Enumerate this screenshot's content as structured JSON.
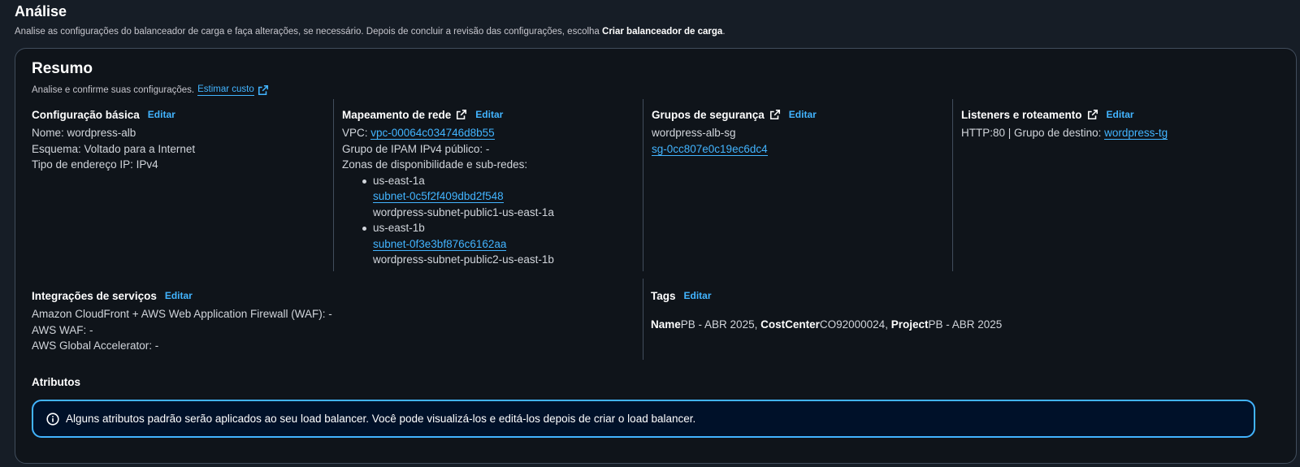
{
  "page": {
    "title": "Análise",
    "description_prefix": "Analise as configurações do balanceador de carga e faça alterações, se necessário. Depois de concluir a revisão das configurações, escolha ",
    "description_bold": "Criar balanceador de carga",
    "description_suffix": "."
  },
  "summary": {
    "title": "Resumo",
    "subtitle": "Analise e confirme suas configurações.",
    "estimate_link": "Estimar custo"
  },
  "basic_config": {
    "heading": "Configuração básica",
    "edit": "Editar",
    "name": "Nome: wordpress-alb",
    "scheme": "Esquema: Voltado para a Internet",
    "ip_type": "Tipo de endereço IP: IPv4"
  },
  "network_mapping": {
    "heading": "Mapeamento de rede",
    "edit": "Editar",
    "vpc_label": "VPC: ",
    "vpc_id": "vpc-00064c034746d8b55",
    "ipam": "Grupo de IPAM IPv4 público: -",
    "zones_label": "Zonas de disponibilidade e sub-redes:",
    "zones": [
      {
        "zone": "us-east-1a",
        "subnet_id": "subnet-0c5f2f409dbd2f548",
        "subnet_name": "wordpress-subnet-public1-us-east-1a"
      },
      {
        "zone": "us-east-1b",
        "subnet_id": "subnet-0f3e3bf876c6162aa",
        "subnet_name": "wordpress-subnet-public2-us-east-1b"
      }
    ]
  },
  "security_groups": {
    "heading": "Grupos de segurança",
    "edit": "Editar",
    "group_name": "wordpress-alb-sg",
    "group_id": "sg-0cc807e0c19ec6dc4"
  },
  "listeners": {
    "heading": "Listeners e roteamento",
    "edit": "Editar",
    "rule_prefix": "HTTP:80 | Grupo de destino: ",
    "target_group": "wordpress-tg"
  },
  "integrations": {
    "heading": "Integrações de serviços",
    "edit": "Editar",
    "lines": [
      "Amazon CloudFront + AWS Web Application Firewall (WAF): -",
      "AWS WAF: -",
      "AWS Global Accelerator: -"
    ]
  },
  "tags": {
    "heading": "Tags",
    "edit": "Editar",
    "items": [
      {
        "key": "Name",
        "value": "PB - ABR 2025",
        "sep": ", "
      },
      {
        "key": "CostCenter",
        "value": "CO92000024",
        "sep": ", "
      },
      {
        "key": "Project",
        "value": "PB - ABR 2025",
        "sep": ""
      }
    ]
  },
  "attributes": {
    "heading": "Atributos",
    "info_text": "Alguns atributos padrão serão aplicados ao seu load balancer. Você pode visualizá-los e editá-los depois de criar o load balancer."
  },
  "icons": {
    "external": "external-link-icon",
    "info": "info-icon"
  },
  "colors": {
    "link": "#42b4ff",
    "background": "#161d26",
    "card": "#0f141a",
    "border": "#414d5c"
  }
}
